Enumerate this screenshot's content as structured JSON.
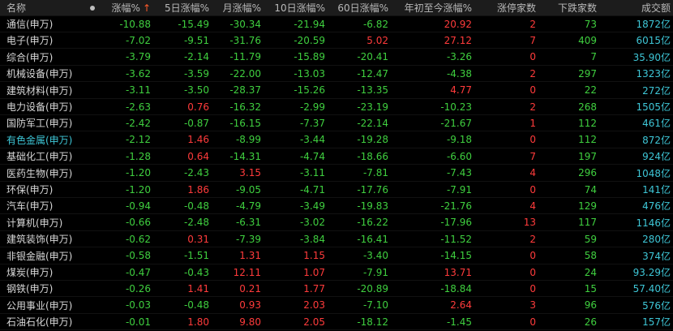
{
  "colors": {
    "background": "#000000",
    "header_bg": "#1c1c1c",
    "up": "#ff3b3b",
    "down": "#3fcf3f",
    "flat": "#d8d8d8",
    "volume": "#3ec6d6",
    "selected_name": "#3ec6d6",
    "sort_arrow": "#ff5a2a"
  },
  "header": {
    "name": "名称",
    "pct": "涨幅%",
    "sort_arrow": "↑",
    "d5": "5日涨幅%",
    "month": "月涨幅%",
    "d10": "10日涨幅%",
    "d60": "60日涨幅%",
    "ytd": "年初至今涨幅%",
    "limit_up": "涨停家数",
    "decliners": "下跌家数",
    "volume": "成交额"
  },
  "rows": [
    {
      "name": "通信(申万)",
      "pct": "-10.88",
      "d5": "-15.49",
      "month": "-30.34",
      "d10": "-21.94",
      "d60": "-6.82",
      "ytd": "20.92",
      "limit_up": "2",
      "decliners": "73",
      "volume": "1872亿"
    },
    {
      "name": "电子(申万)",
      "pct": "-7.02",
      "d5": "-9.51",
      "month": "-31.76",
      "d10": "-20.59",
      "d60": "5.02",
      "ytd": "27.12",
      "limit_up": "7",
      "decliners": "409",
      "volume": "6015亿"
    },
    {
      "name": "综合(申万)",
      "pct": "-3.79",
      "d5": "-2.14",
      "month": "-11.79",
      "d10": "-15.89",
      "d60": "-20.41",
      "ytd": "-3.26",
      "limit_up": "0",
      "decliners": "7",
      "volume": "35.90亿"
    },
    {
      "name": "机械设备(申万)",
      "pct": "-3.62",
      "d5": "-3.59",
      "month": "-22.00",
      "d10": "-13.03",
      "d60": "-12.47",
      "ytd": "-4.38",
      "limit_up": "2",
      "decliners": "297",
      "volume": "1323亿"
    },
    {
      "name": "建筑材料(申万)",
      "pct": "-3.11",
      "d5": "-3.50",
      "month": "-28.37",
      "d10": "-15.26",
      "d60": "-13.35",
      "ytd": "4.77",
      "limit_up": "0",
      "decliners": "22",
      "volume": "272亿"
    },
    {
      "name": "电力设备(申万)",
      "pct": "-2.63",
      "d5": "0.76",
      "month": "-16.32",
      "d10": "-2.99",
      "d60": "-23.19",
      "ytd": "-10.23",
      "limit_up": "2",
      "decliners": "268",
      "volume": "1505亿"
    },
    {
      "name": "国防军工(申万)",
      "pct": "-2.42",
      "d5": "-0.87",
      "month": "-16.15",
      "d10": "-7.37",
      "d60": "-22.14",
      "ytd": "-21.67",
      "limit_up": "1",
      "decliners": "112",
      "volume": "461亿"
    },
    {
      "name": "有色金属(申万)",
      "pct": "-2.12",
      "d5": "1.46",
      "month": "-8.99",
      "d10": "-3.44",
      "d60": "-19.28",
      "ytd": "-9.18",
      "limit_up": "0",
      "decliners": "112",
      "volume": "872亿",
      "highlight": true
    },
    {
      "name": "基础化工(申万)",
      "pct": "-1.28",
      "d5": "0.64",
      "month": "-14.31",
      "d10": "-4.74",
      "d60": "-18.66",
      "ytd": "-6.60",
      "limit_up": "7",
      "decliners": "197",
      "volume": "924亿"
    },
    {
      "name": "医药生物(申万)",
      "pct": "-1.20",
      "d5": "-2.43",
      "month": "3.15",
      "d10": "-3.11",
      "d60": "-7.81",
      "ytd": "-7.43",
      "limit_up": "4",
      "decliners": "296",
      "volume": "1048亿"
    },
    {
      "name": "环保(申万)",
      "pct": "-1.20",
      "d5": "1.86",
      "month": "-9.05",
      "d10": "-4.71",
      "d60": "-17.76",
      "ytd": "-7.91",
      "limit_up": "0",
      "decliners": "74",
      "volume": "141亿"
    },
    {
      "name": "汽车(申万)",
      "pct": "-0.94",
      "d5": "-0.48",
      "month": "-4.79",
      "d10": "-3.49",
      "d60": "-19.83",
      "ytd": "-21.76",
      "limit_up": "4",
      "decliners": "129",
      "volume": "476亿"
    },
    {
      "name": "计算机(申万)",
      "pct": "-0.66",
      "d5": "-2.48",
      "month": "-6.31",
      "d10": "-3.02",
      "d60": "-16.22",
      "ytd": "-17.96",
      "limit_up": "13",
      "decliners": "117",
      "volume": "1146亿"
    },
    {
      "name": "建筑装饰(申万)",
      "pct": "-0.62",
      "d5": "0.31",
      "month": "-7.39",
      "d10": "-3.84",
      "d60": "-16.41",
      "ytd": "-11.52",
      "limit_up": "2",
      "decliners": "59",
      "volume": "280亿"
    },
    {
      "name": "非银金融(申万)",
      "pct": "-0.58",
      "d5": "-1.51",
      "month": "1.31",
      "d10": "1.15",
      "d60": "-3.40",
      "ytd": "-14.15",
      "limit_up": "0",
      "decliners": "58",
      "volume": "374亿"
    },
    {
      "name": "煤炭(申万)",
      "pct": "-0.47",
      "d5": "-0.43",
      "month": "12.11",
      "d10": "1.07",
      "d60": "-7.91",
      "ytd": "13.71",
      "limit_up": "0",
      "decliners": "24",
      "volume": "93.29亿"
    },
    {
      "name": "钢铁(申万)",
      "pct": "-0.26",
      "d5": "1.41",
      "month": "0.21",
      "d10": "1.77",
      "d60": "-20.89",
      "ytd": "-18.84",
      "limit_up": "0",
      "decliners": "15",
      "volume": "57.40亿"
    },
    {
      "name": "公用事业(申万)",
      "pct": "-0.03",
      "d5": "-0.48",
      "month": "0.93",
      "d10": "2.03",
      "d60": "-7.10",
      "ytd": "2.64",
      "limit_up": "3",
      "decliners": "96",
      "volume": "576亿"
    },
    {
      "name": "石油石化(申万)",
      "pct": "-0.01",
      "d5": "1.80",
      "month": "9.80",
      "d10": "2.05",
      "d60": "-18.12",
      "ytd": "-1.45",
      "limit_up": "0",
      "decliners": "26",
      "volume": "157亿"
    }
  ]
}
